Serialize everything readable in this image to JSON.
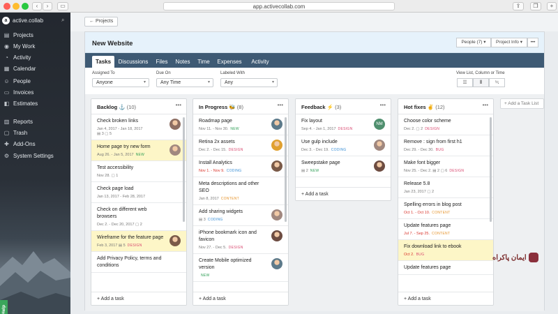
{
  "browser": {
    "url": "app.activecollab.com",
    "back": "‹",
    "forward": "›",
    "share_icon": "share-icon",
    "tabs_icon": "tabs-icon",
    "new_tab": "+"
  },
  "sidebar": {
    "brand": "active.collab",
    "items": [
      {
        "label": "Projects",
        "icon": "▤"
      },
      {
        "label": "My Work",
        "icon": "◉"
      },
      {
        "label": "Activity",
        "icon": "◔"
      },
      {
        "label": "Calendar",
        "icon": "▦"
      },
      {
        "label": "People",
        "icon": "☺"
      },
      {
        "label": "Invoices",
        "icon": "▭"
      },
      {
        "label": "Estimates",
        "icon": "◧"
      },
      {
        "label": "Reports",
        "icon": "▥"
      },
      {
        "label": "Trash",
        "icon": "▢"
      },
      {
        "label": "Add-Ons",
        "icon": "✚"
      },
      {
        "label": "System Settings",
        "icon": "⚙"
      }
    ],
    "help": "Help"
  },
  "topbar": {
    "projects_button": "← Projects"
  },
  "project": {
    "title": "New Website",
    "people_button": "People (7) ▾",
    "info_button": "Project Info ▾",
    "more_button": "•••"
  },
  "tabs": [
    "Tasks",
    "Discussions",
    "Files",
    "Notes",
    "Time",
    "Expenses",
    "Activity"
  ],
  "filters": {
    "assigned_label": "Assigned To",
    "assigned_value": "Anyone",
    "due_label": "Due On",
    "due_value": "Any Time",
    "labeled_label": "Labeled With",
    "labeled_value": "Any",
    "view_label": "View List, Column or Time"
  },
  "columns": [
    {
      "title": "Backlog ⚓",
      "count": "(10)",
      "add": "+ Add a task",
      "tasks": [
        {
          "title": "Check broken links",
          "meta": "Jan 4, 2017 - Jan 18, 2017",
          "extra": "▤ 3  ▢ 5",
          "avatar": true,
          "hl": false
        },
        {
          "title": "Home page try new form",
          "meta": "Aug 26. - Jan 5, 2017",
          "label": "NEW",
          "label_color": "#2e9e55",
          "avatar": true,
          "hl": true
        },
        {
          "title": "Test accessibility",
          "meta": "Nov 28. ▢ 1",
          "avatar": false,
          "hl": false
        },
        {
          "title": "Check page load",
          "meta": "Jan 13, 2017 - Feb 28, 2017",
          "avatar": false,
          "hl": false
        },
        {
          "title": "Check on different web browsers",
          "meta": "Dec 2. - Dec 20, 2017 ▢ 2",
          "avatar": false,
          "hl": false
        },
        {
          "title": "Wireframe for the feature page",
          "meta": "Feb 3, 2017 ▤ 5",
          "label": "DESIGN",
          "label_color": "#d9486f",
          "avatar": true,
          "hl": true
        },
        {
          "title": "Add Privacy Policy, terms and conditions",
          "meta": "",
          "avatar": false,
          "hl": false
        }
      ]
    },
    {
      "title": "In Progress 🐝",
      "count": "(8)",
      "add": "+ Add a task",
      "tasks": [
        {
          "title": "Roadmap page",
          "meta": "Nov 11. - Nov 30.",
          "label": "NEW",
          "label_color": "#2e9e55",
          "avatar": true,
          "hl": false
        },
        {
          "title": "Retina 2x assets",
          "meta": "Dec 2. - Dec 15.",
          "label": "DESIGN",
          "label_color": "#d9486f",
          "avatar": true,
          "hl": false
        },
        {
          "title": "Install Analytics",
          "meta": "Nov 1. - Nov 9.",
          "late": true,
          "label": "CODING",
          "label_color": "#3a8fd6",
          "avatar": true,
          "hl": false
        },
        {
          "title": "Meta descriptions and other SEO",
          "meta": "Jan 8, 2017",
          "label": "CONTENT",
          "label_color": "#e5932a",
          "avatar": false,
          "hl": false
        },
        {
          "title": "Add sharing widgets",
          "meta": "▤ 3",
          "label": "CODING",
          "label_color": "#3a8fd6",
          "avatar": true,
          "hl": false
        },
        {
          "title": "iPhone bookmark icon and favicon",
          "meta": "Nov 27. - Dec 5.",
          "label": "DESIGN",
          "label_color": "#d9486f",
          "avatar": true,
          "hl": false
        },
        {
          "title": "Create Mobile optimized version",
          "meta": "",
          "label": "NEW",
          "label_color": "#2e9e55",
          "avatar": true,
          "hl": false
        }
      ]
    },
    {
      "title": "Feedback ⚡",
      "count": "(3)",
      "add": "+ Add a task",
      "tasks": [
        {
          "title": "Fix layout",
          "meta": "Sep 4. - Jan 1, 2017",
          "label": "DESIGN",
          "label_color": "#d9486f",
          "avatar": true,
          "initials": "NM",
          "hl": false
        },
        {
          "title": "Use gulp include",
          "meta": "Dec 3. - Dec 19.",
          "label": "CODING",
          "label_color": "#3a8fd6",
          "avatar": true,
          "hl": false
        },
        {
          "title": "Sweepstake page",
          "meta": "▤ 2",
          "label": "NEW",
          "label_color": "#2e9e55",
          "avatar": true,
          "hl": false
        }
      ]
    },
    {
      "title": "Hot fixes ✌",
      "count": "(12)",
      "add": "+ Add a task",
      "tasks": [
        {
          "title": "Choose color scheme",
          "meta": "Dec 2. ▢ 2",
          "label": "DESIGN",
          "label_color": "#d9486f",
          "avatar": false,
          "hl": false
        },
        {
          "title": "Remove : sign from first h1",
          "meta": "Dec 29. - Dec 30.",
          "label": "BUG",
          "label_color": "#d9486f",
          "avatar": false,
          "hl": false
        },
        {
          "title": "Make font bigger",
          "meta": "Nov 25. - Dec 2. ▤ 2 ▢ 6",
          "label": "DESIGN",
          "label_color": "#d9486f",
          "avatar": false,
          "hl": false
        },
        {
          "title": "Release 5.8",
          "meta": "Jan 23, 2017 ▢ 2",
          "avatar": false,
          "hl": false
        },
        {
          "title": "Spelling errors in blog post",
          "meta": "Oct 1. - Oct 10.",
          "late": true,
          "label": "CONTENT",
          "label_color": "#e5932a",
          "avatar": false,
          "hl": false
        },
        {
          "title": "Update features page",
          "meta": "Jul 7. - Sep 25.",
          "late": true,
          "label": "CONTENT",
          "label_color": "#e5932a",
          "avatar": false,
          "hl": false
        },
        {
          "title": "Fix download link to ebook",
          "meta": "Oct 2.",
          "late": true,
          "label": "BUG",
          "label_color": "#d9486f",
          "avatar": false,
          "hl": true
        },
        {
          "title": "Update features page",
          "meta": "",
          "avatar": false,
          "hl": false
        }
      ]
    }
  ],
  "add_list": "+ Add a Task List",
  "watermark": "ایمان پاکراه"
}
